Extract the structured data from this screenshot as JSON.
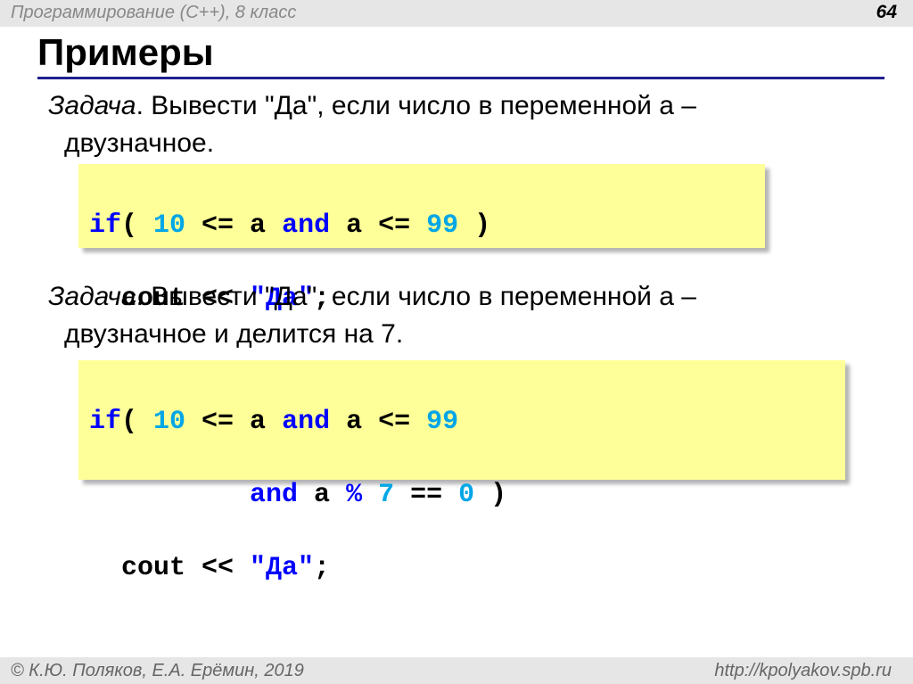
{
  "header": {
    "course": "Программирование (С++), 8 класс",
    "page_number": "64"
  },
  "title": "Примеры",
  "task1": {
    "label": "Задача",
    "line1": ". Вывести \"Да\", если число в переменной a –",
    "line2": "двузначное."
  },
  "code1": {
    "l1_kw": "if",
    "l1_a": "( ",
    "l1_n1": "10",
    "l1_b": " <= a ",
    "l1_and": "and",
    "l1_c": " a <= ",
    "l1_n2": "99",
    "l1_d": " )",
    "l2_a": "  cout << ",
    "l2_str": "\"Да\"",
    "l2_b": ";"
  },
  "task2": {
    "label": "Задача",
    "line1": ". Вывести \"Да\", если число в переменной a –",
    "line2": "двузначное и делится на 7."
  },
  "code2": {
    "l1_kw": "if",
    "l1_a": "( ",
    "l1_n1": "10",
    "l1_b": " <= a ",
    "l1_and": "and",
    "l1_c": " a <= ",
    "l1_n2": "99",
    "l2_pad": "          ",
    "l2_and": "and",
    "l2_a": " a ",
    "l2_pct": "%",
    "l2_sp": " ",
    "l2_n7": "7",
    "l2_b": " == ",
    "l2_n0": "0",
    "l2_c": " )",
    "l3_a": "  cout << ",
    "l3_str": "\"Да\"",
    "l3_b": ";"
  },
  "footer": {
    "authors": "© К.Ю. Поляков, Е.А. Ерёмин, 2019",
    "url": "http://kpolyakov.spb.ru"
  }
}
